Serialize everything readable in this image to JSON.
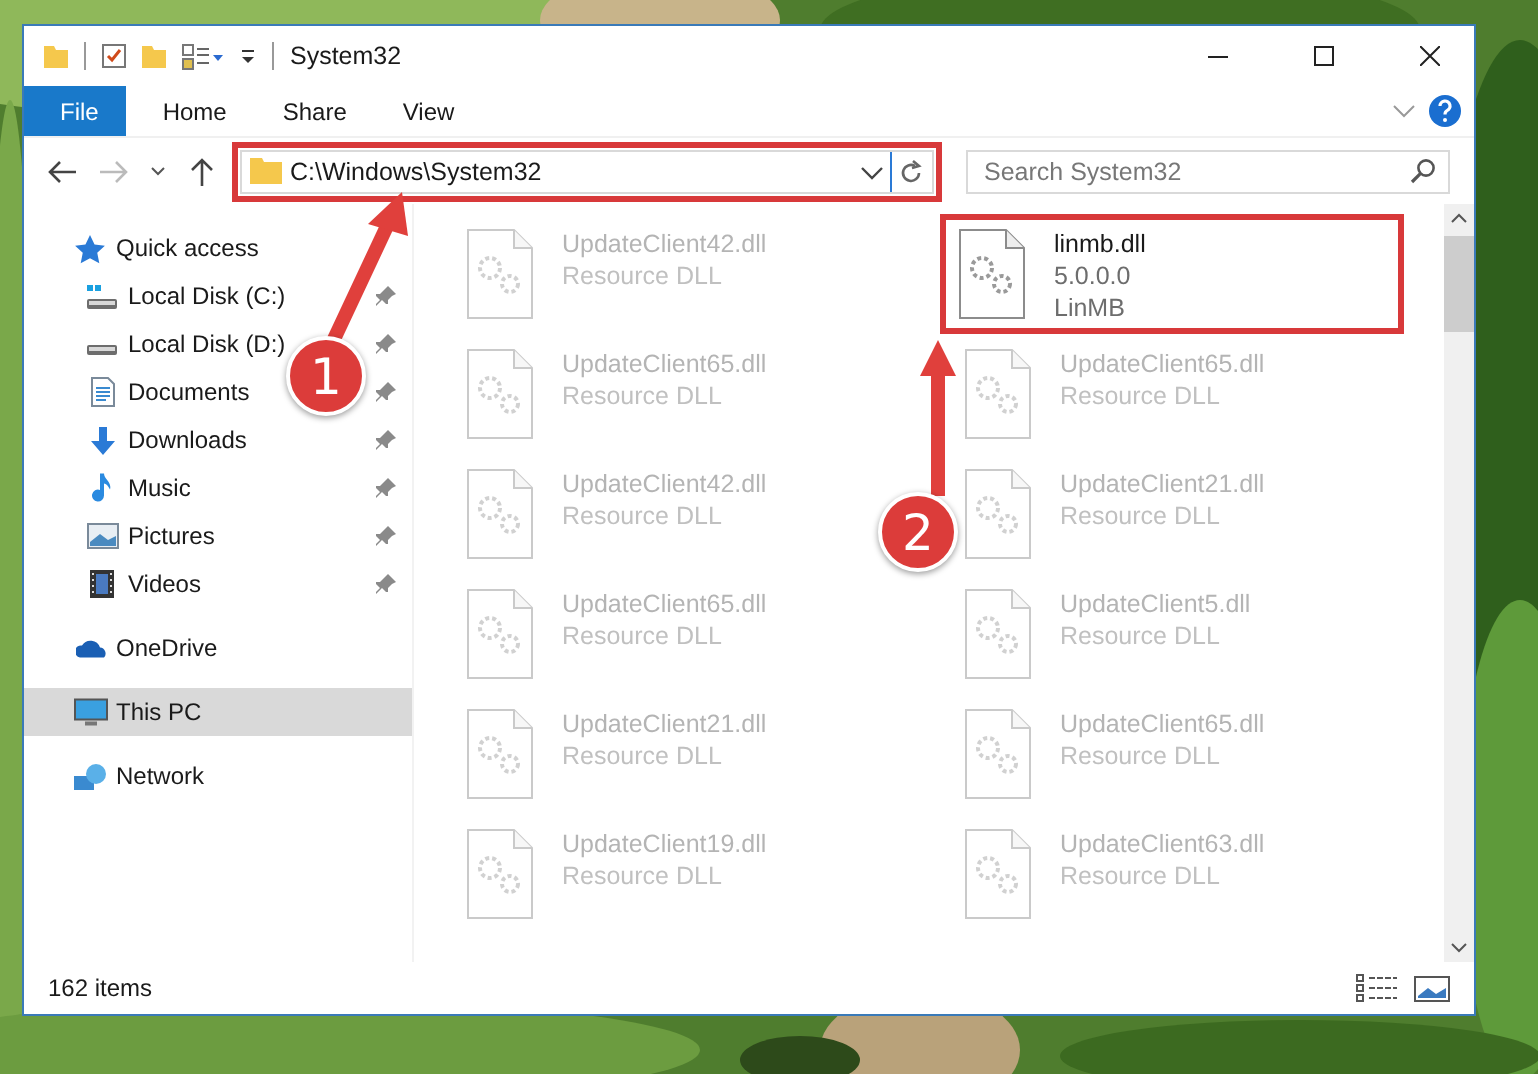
{
  "window": {
    "title": "System32"
  },
  "ribbon_tabs": [
    {
      "label": "File",
      "kind": "file"
    },
    {
      "label": "Home",
      "kind": "tab"
    },
    {
      "label": "Share",
      "kind": "tab"
    },
    {
      "label": "View",
      "kind": "tab"
    }
  ],
  "address": {
    "path": "C:\\Windows\\System32",
    "highlighted": true
  },
  "search": {
    "placeholder": "Search System32"
  },
  "nav": [
    {
      "label": "Quick access",
      "kind": "star",
      "selected": false,
      "children": [
        {
          "label": "Local Disk (C:)",
          "kind": "system-drive",
          "pinned": true
        },
        {
          "label": "Local Disk (D:)",
          "kind": "drive",
          "pinned": true
        },
        {
          "label": "Documents",
          "kind": "documents",
          "pinned": true
        },
        {
          "label": "Downloads",
          "kind": "downloads",
          "pinned": true
        },
        {
          "label": "Music",
          "kind": "music",
          "pinned": true
        },
        {
          "label": "Pictures",
          "kind": "pictures",
          "pinned": true
        },
        {
          "label": "Videos",
          "kind": "videos",
          "pinned": true
        }
      ]
    },
    {
      "label": "OneDrive",
      "kind": "cloud",
      "selected": false
    },
    {
      "label": "This PC",
      "kind": "pc",
      "selected": true
    },
    {
      "label": "Network",
      "kind": "network",
      "selected": false
    }
  ],
  "files": [
    {
      "name": "UpdateClient42.dll",
      "details": [
        "Resource DLL"
      ],
      "faded": true,
      "highlighted": false
    },
    {
      "name": "linmb.dll",
      "details": [
        "5.0.0.0",
        "LinMB"
      ],
      "faded": false,
      "highlighted": true
    },
    {
      "name": "UpdateClient65.dll",
      "details": [
        "Resource DLL"
      ],
      "faded": true,
      "highlighted": false
    },
    {
      "name": "UpdateClient65.dll",
      "details": [
        "Resource DLL"
      ],
      "faded": true,
      "highlighted": false
    },
    {
      "name": "UpdateClient42.dll",
      "details": [
        "Resource DLL"
      ],
      "faded": true,
      "highlighted": false
    },
    {
      "name": "UpdateClient21.dll",
      "details": [
        "Resource DLL"
      ],
      "faded": true,
      "highlighted": false
    },
    {
      "name": "UpdateClient65.dll",
      "details": [
        "Resource DLL"
      ],
      "faded": true,
      "highlighted": false
    },
    {
      "name": "UpdateClient5.dll",
      "details": [
        "Resource DLL"
      ],
      "faded": true,
      "highlighted": false
    },
    {
      "name": "UpdateClient21.dll",
      "details": [
        "Resource DLL"
      ],
      "faded": true,
      "highlighted": false
    },
    {
      "name": "UpdateClient65.dll",
      "details": [
        "Resource DLL"
      ],
      "faded": true,
      "highlighted": false
    },
    {
      "name": "UpdateClient19.dll",
      "details": [
        "Resource DLL"
      ],
      "faded": true,
      "highlighted": false
    },
    {
      "name": "UpdateClient63.dll",
      "details": [
        "Resource DLL"
      ],
      "faded": true,
      "highlighted": false
    }
  ],
  "status_bar": {
    "item_count": "162 items"
  },
  "annotations": [
    {
      "number": "1"
    },
    {
      "number": "2"
    }
  ]
}
